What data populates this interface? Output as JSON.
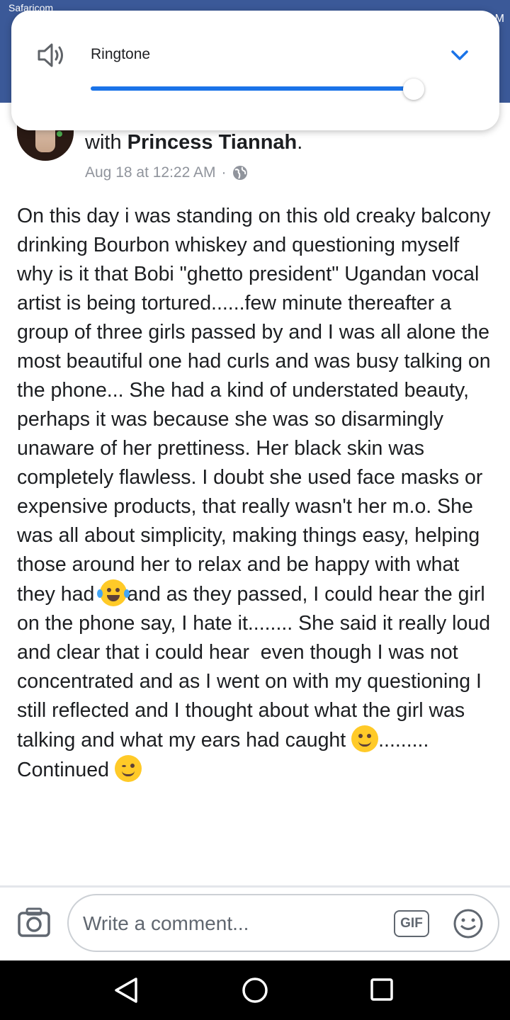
{
  "status_bar": {
    "carrier": "Safaricom",
    "time": "M"
  },
  "volume_panel": {
    "label": "Ringtone",
    "level": 0.97,
    "accent": "#1a73e8"
  },
  "post": {
    "with_prefix": "with ",
    "tagged_name": "Princess Tiannah",
    "with_suffix": ".",
    "timestamp": "Aug 18 at 12:22 AM",
    "separator": "·",
    "privacy_icon": "globe-icon",
    "body_1": "On this day i was standing on this old creaky balcony drinking Bourbon whiskey and questioning myself why is it that Bobi \"ghetto president\" Ugandan vocal artist is being tortured......few minute thereafter a group of three girls passed by and I was all alone the most beautiful one had curls and was busy talking on the phone... She had a kind of understated beauty, perhaps it was because she was so disarmingly unaware of her prettiness. Her black skin was completely flawless. I doubt she used face masks or expensive products, that really wasn't her m.o. She was all about simplicity, making things easy, helping those around her to relax and be happy with what they had ",
    "body_2": "and as they passed, I could hear the girl on the phone say, I hate it........ She said it really loud and clear that i could hear  even though I was not concentrated and as I went on with my questioning I still reflected and I thought about what the girl was talking and what my ears had caught ",
    "body_3": "......... Continued ",
    "emojis": [
      "laughing-tears-emoji",
      "smiling-emoji",
      "winking-emoji"
    ]
  },
  "comment_bar": {
    "placeholder": "Write a comment...",
    "gif_label": "GIF"
  },
  "nav": [
    "back-icon",
    "home-icon",
    "recents-icon"
  ],
  "colors": {
    "facebook_blue": "#3b5998",
    "text": "#1c1e21",
    "muted": "#90949c"
  }
}
